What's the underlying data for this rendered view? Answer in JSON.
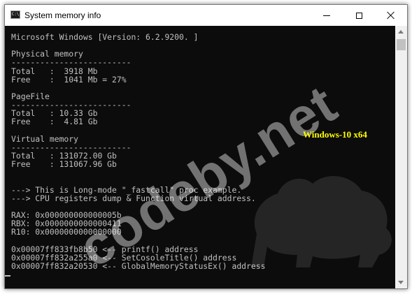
{
  "window": {
    "title": "System memory info",
    "icon_text": "C:\\",
    "icon_name": "console-app-icon"
  },
  "console": {
    "lines": [
      "Microsoft Windows [Version: 6.2.9200. ]",
      "",
      "Physical memory",
      "-------------------------",
      "Total   :  3918 Mb",
      "Free    :  1041 Mb = 27%",
      "",
      "PageFile",
      "-------------------------",
      "Total   : 10.33 Gb",
      "Free    :  4.81 Gb",
      "",
      "Virtual memory",
      "-------------------------",
      "Total   : 131072.00 Gb",
      "Free    : 131067.96 Gb",
      "",
      "",
      "---> This is Long-mode \"_fastcall\" proc example.",
      "---> CPU registers dump & Function virtual address.",
      "",
      "RAX: 0x000000000000005b",
      "RBX: 0x0000000000000411",
      "R10: 0x0000000000000000",
      "",
      "0x00007ff833fb8b50 <-- printf() address",
      "0x00007ff832a255a0 <-- SetCosoleTitle() address",
      "0x00007ff832a20530 <-- GlobalMemoryStatusEx() address"
    ]
  },
  "overlay": {
    "watermark": "codeby.net",
    "os_label": "Windows-10 x64"
  },
  "colors": {
    "console_bg": "#0c0c0c",
    "console_text": "#c0c0c0",
    "os_label": "#ffff00",
    "titlebar_bg": "#ffffff"
  }
}
